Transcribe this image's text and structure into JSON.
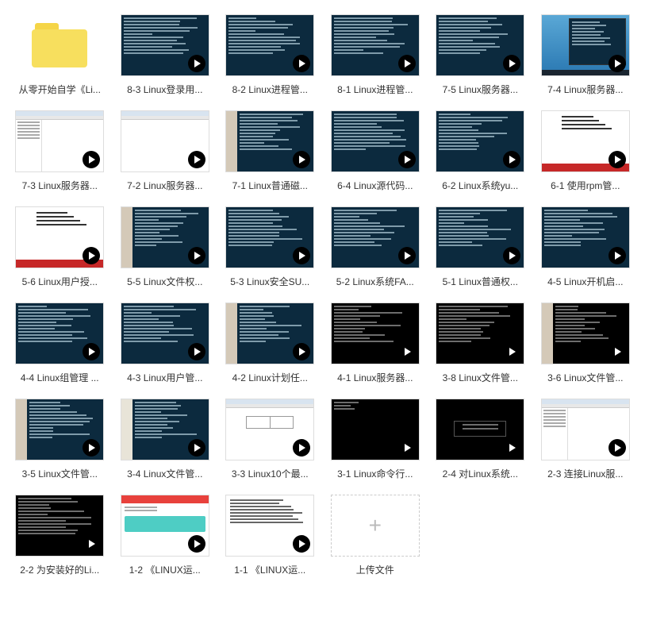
{
  "items": [
    {
      "kind": "folder",
      "label": "从零开始自学《Li...",
      "name": "folder-linux-self-study"
    },
    {
      "kind": "terminal",
      "label": "8-3 Linux登录用...",
      "name": "video-8-3-linux-login"
    },
    {
      "kind": "terminal",
      "label": "8-2 Linux进程管...",
      "name": "video-8-2-linux-process"
    },
    {
      "kind": "terminal",
      "label": "8-1 Linux进程管...",
      "name": "video-8-1-linux-process"
    },
    {
      "kind": "terminal",
      "label": "7-5 Linux服务器...",
      "name": "video-7-5-linux-server"
    },
    {
      "kind": "desktop",
      "label": "7-4 Linux服务器...",
      "name": "video-7-4-linux-server"
    },
    {
      "kind": "app",
      "label": "7-3 Linux服务器...",
      "name": "video-7-3-linux-server"
    },
    {
      "kind": "app-blank",
      "label": "7-2 Linux服务器...",
      "name": "video-7-2-linux-server"
    },
    {
      "kind": "split-term",
      "label": "7-1 Linux普通磁...",
      "name": "video-7-1-linux-disk"
    },
    {
      "kind": "terminal",
      "label": "6-4 Linux源代码...",
      "name": "video-6-4-linux-source"
    },
    {
      "kind": "terminal",
      "label": "6-2 Linux系统yu...",
      "name": "video-6-2-linux-yum"
    },
    {
      "kind": "slide",
      "label": "6-1 使用rpm管...",
      "name": "video-6-1-rpm"
    },
    {
      "kind": "slide",
      "label": "5-6 Linux用户授...",
      "name": "video-5-6-linux-user-auth"
    },
    {
      "kind": "split-term",
      "label": "5-5 Linux文件权...",
      "name": "video-5-5-linux-file-perm"
    },
    {
      "kind": "terminal",
      "label": "5-3 Linux安全SU...",
      "name": "video-5-3-linux-su"
    },
    {
      "kind": "terminal",
      "label": "5-2 Linux系统FA...",
      "name": "video-5-2-linux-fa"
    },
    {
      "kind": "terminal",
      "label": "5-1 Linux普通权...",
      "name": "video-5-1-linux-perm"
    },
    {
      "kind": "terminal",
      "label": "4-5 Linux开机启...",
      "name": "video-4-5-linux-boot"
    },
    {
      "kind": "terminal",
      "label": "4-4 Linux组管理 ...",
      "name": "video-4-4-linux-group"
    },
    {
      "kind": "terminal",
      "label": "4-3 Linux用户管...",
      "name": "video-4-3-linux-user"
    },
    {
      "kind": "split-term",
      "label": "4-2 Linux计划任...",
      "name": "video-4-2-linux-cron"
    },
    {
      "kind": "term-dark",
      "label": "4-1 Linux服务器...",
      "name": "video-4-1-linux-server"
    },
    {
      "kind": "term-dark",
      "label": "3-8 Linux文件管...",
      "name": "video-3-8-linux-file"
    },
    {
      "kind": "split-dark",
      "label": "3-6 Linux文件管...",
      "name": "video-3-6-linux-file"
    },
    {
      "kind": "split-term",
      "label": "3-5 Linux文件管...",
      "name": "video-3-5-linux-file"
    },
    {
      "kind": "split-term2",
      "label": "3-4 Linux文件管...",
      "name": "video-3-4-linux-file"
    },
    {
      "kind": "boxed",
      "label": "3-3 Linux10个最...",
      "name": "video-3-3-linux-10"
    },
    {
      "kind": "term-dark-min",
      "label": "3-1 Linux命令行...",
      "name": "video-3-1-linux-cmd"
    },
    {
      "kind": "dark-box",
      "label": "2-4 对Linux系统...",
      "name": "video-2-4-linux-system"
    },
    {
      "kind": "app",
      "label": "2-3 连接Linux服...",
      "name": "video-2-3-linux-connect"
    },
    {
      "kind": "term-dark",
      "label": "2-2 为安装好的Li...",
      "name": "video-2-2-linux-installed"
    },
    {
      "kind": "web",
      "label": "1-2 《LINUX运...",
      "name": "video-1-2-linux-ops"
    },
    {
      "kind": "doc",
      "label": "1-1 《LINUX运...",
      "name": "video-1-1-linux-ops"
    },
    {
      "kind": "upload",
      "label": "上传文件",
      "name": "upload-file"
    }
  ]
}
